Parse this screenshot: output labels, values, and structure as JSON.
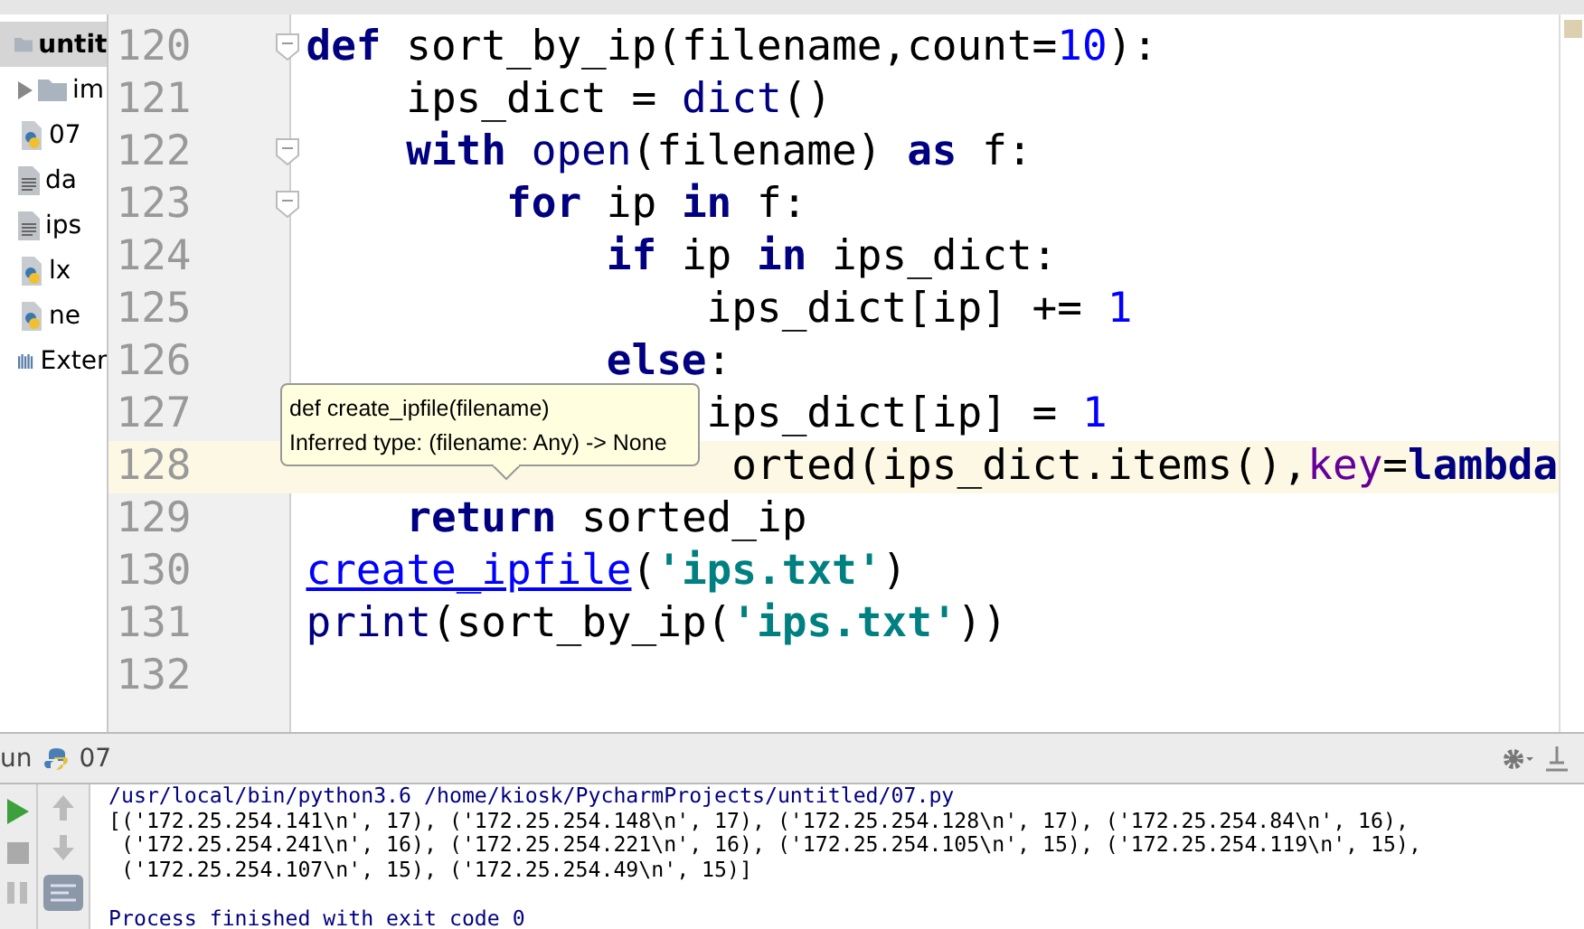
{
  "project_tree": [
    {
      "label": "untit",
      "kind": "folder",
      "selected": true,
      "arrow": false
    },
    {
      "label": "im",
      "kind": "folder",
      "selected": false,
      "arrow": true
    },
    {
      "label": "07",
      "kind": "python",
      "selected": false,
      "arrow": false
    },
    {
      "label": "da",
      "kind": "text",
      "selected": false,
      "arrow": false
    },
    {
      "label": "ips",
      "kind": "text",
      "selected": false,
      "arrow": false
    },
    {
      "label": "lx",
      "kind": "python",
      "selected": false,
      "arrow": false
    },
    {
      "label": "ne",
      "kind": "python",
      "selected": false,
      "arrow": false
    },
    {
      "label": "Exter",
      "kind": "library",
      "selected": false,
      "arrow": false
    }
  ],
  "editor": {
    "lines": [
      {
        "number": "120",
        "current": false,
        "fold": true,
        "tokens": [
          {
            "t": "def",
            "kind": "kw"
          },
          {
            "t": " sort_by_ip(filename,count=",
            "kind": "plain"
          },
          {
            "t": "10",
            "kind": "num"
          },
          {
            "t": "):",
            "kind": "plain"
          }
        ]
      },
      {
        "number": "121",
        "current": false,
        "fold": false,
        "tokens": [
          {
            "t": "    ips_dict = ",
            "kind": "plain"
          },
          {
            "t": "dict",
            "kind": "builtin"
          },
          {
            "t": "()",
            "kind": "plain"
          }
        ]
      },
      {
        "number": "122",
        "current": false,
        "fold": true,
        "tokens": [
          {
            "t": "    with",
            "kind": "kw"
          },
          {
            "t": " open",
            "kind": "builtin"
          },
          {
            "t": "(filename) ",
            "kind": "plain"
          },
          {
            "t": "as",
            "kind": "kw"
          },
          {
            "t": " f:",
            "kind": "plain"
          }
        ]
      },
      {
        "number": "123",
        "current": false,
        "fold": true,
        "tokens": [
          {
            "t": "        for",
            "kind": "kw"
          },
          {
            "t": " ip ",
            "kind": "plain"
          },
          {
            "t": "in",
            "kind": "kw"
          },
          {
            "t": " f:",
            "kind": "plain"
          }
        ]
      },
      {
        "number": "124",
        "current": false,
        "fold": false,
        "tokens": [
          {
            "t": "            if",
            "kind": "kw"
          },
          {
            "t": " ip ",
            "kind": "plain"
          },
          {
            "t": "in",
            "kind": "kw"
          },
          {
            "t": " ips_dict:",
            "kind": "plain"
          }
        ]
      },
      {
        "number": "125",
        "current": false,
        "fold": false,
        "tokens": [
          {
            "t": "                ips_dict[ip] += ",
            "kind": "plain"
          },
          {
            "t": "1",
            "kind": "num"
          }
        ]
      },
      {
        "number": "126",
        "current": false,
        "fold": false,
        "tokens": [
          {
            "t": "            else",
            "kind": "kw"
          },
          {
            "t": ":",
            "kind": "plain"
          }
        ]
      },
      {
        "number": "127",
        "current": false,
        "fold": false,
        "tokens": [
          {
            "t": "                ips_dict[ip] = ",
            "kind": "plain"
          },
          {
            "t": "1",
            "kind": "num"
          }
        ]
      },
      {
        "number": "128",
        "current": true,
        "fold": false,
        "tokens": [
          {
            "t": "                 orted(ips_dict.items(),",
            "kind": "plain"
          },
          {
            "t": "key",
            "kind": "param"
          },
          {
            "t": "=",
            "kind": "plain"
          },
          {
            "t": "lambda",
            "kind": "kw"
          }
        ]
      },
      {
        "number": "129",
        "current": false,
        "fold": false,
        "tokens": [
          {
            "t": "    return",
            "kind": "kw"
          },
          {
            "t": " sorted_ip",
            "kind": "plain"
          }
        ]
      },
      {
        "number": "130",
        "current": false,
        "fold": false,
        "tokens": [
          {
            "t": "create_ipfile",
            "kind": "link"
          },
          {
            "t": "(",
            "kind": "plain"
          },
          {
            "t": "'ips.txt'",
            "kind": "str"
          },
          {
            "t": ")",
            "kind": "plain"
          }
        ]
      },
      {
        "number": "131",
        "current": false,
        "fold": false,
        "tokens": [
          {
            "t": "print",
            "kind": "builtin"
          },
          {
            "t": "(sort_by_ip(",
            "kind": "plain"
          },
          {
            "t": "'ips.txt'",
            "kind": "str"
          },
          {
            "t": "))",
            "kind": "plain"
          }
        ]
      },
      {
        "number": "132",
        "current": false,
        "fold": false
      }
    ],
    "tooltip": {
      "signature": "def create_ipfile(filename)",
      "inferred": "Inferred type: (filename: Any) -> None"
    }
  },
  "run_panel": {
    "title_prefix": "un",
    "config": "07",
    "output": [
      {
        "t": "/usr/local/bin/python3.6 /home/kiosk/PycharmProjects/untitled/07.py",
        "kind": "system"
      },
      {
        "t": "[('172.25.254.141\\n', 17), ('172.25.254.148\\n', 17), ('172.25.254.128\\n', 17), ('172.25.254.84\\n', 16),",
        "kind": "out"
      },
      {
        "t": " ('172.25.254.241\\n', 16), ('172.25.254.221\\n', 16), ('172.25.254.105\\n', 15), ('172.25.254.119\\n', 15),",
        "kind": "out"
      },
      {
        "t": " ('172.25.254.107\\n', 15), ('172.25.254.49\\n', 15)]",
        "kind": "out"
      },
      {
        "kind": "blank"
      },
      {
        "t": "Process finished with exit code 0",
        "kind": "system"
      }
    ]
  }
}
